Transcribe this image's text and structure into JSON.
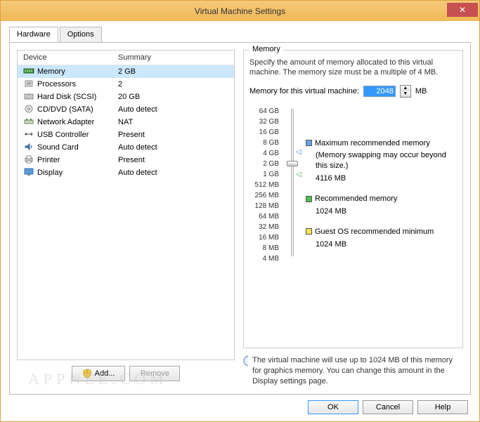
{
  "window": {
    "title": "Virtual Machine Settings"
  },
  "tabs": {
    "hardware": "Hardware",
    "options": "Options"
  },
  "device_list": {
    "headers": {
      "device": "Device",
      "summary": "Summary"
    },
    "rows": [
      {
        "name": "Memory",
        "summary": "2 GB",
        "selected": true
      },
      {
        "name": "Processors",
        "summary": "2"
      },
      {
        "name": "Hard Disk (SCSI)",
        "summary": "20 GB"
      },
      {
        "name": "CD/DVD (SATA)",
        "summary": "Auto detect"
      },
      {
        "name": "Network Adapter",
        "summary": "NAT"
      },
      {
        "name": "USB Controller",
        "summary": "Present"
      },
      {
        "name": "Sound Card",
        "summary": "Auto detect"
      },
      {
        "name": "Printer",
        "summary": "Present"
      },
      {
        "name": "Display",
        "summary": "Auto detect"
      }
    ]
  },
  "buttons": {
    "add": "Add...",
    "remove": "Remove",
    "ok": "OK",
    "cancel": "Cancel",
    "help": "Help"
  },
  "memory": {
    "group_title": "Memory",
    "description": "Specify the amount of memory allocated to this virtual machine. The memory size must be a multiple of 4 MB.",
    "label": "Memory for this virtual machine:",
    "value": "2048",
    "unit": "MB",
    "ticks": [
      "64 GB",
      "32 GB",
      "16 GB",
      "8 GB",
      "4 GB",
      "2 GB",
      "1 GB",
      "512 MB",
      "256 MB",
      "128 MB",
      "64 MB",
      "32 MB",
      "16 MB",
      "8 MB",
      "4 MB"
    ],
    "legend": {
      "max": {
        "label": "Maximum recommended memory",
        "note": "(Memory swapping may occur beyond this size.)",
        "value": "4116 MB",
        "color": "#6aa3e8"
      },
      "rec": {
        "label": "Recommended memory",
        "value": "1024 MB",
        "color": "#4fc14f"
      },
      "min": {
        "label": "Guest OS recommended minimum",
        "value": "1024 MB",
        "color": "#f2e24f"
      }
    },
    "info": "The virtual machine will use up to 1024 MB of this memory for graphics memory. You can change this amount in the Display settings page."
  },
  "watermark": "APPNEE.COM"
}
